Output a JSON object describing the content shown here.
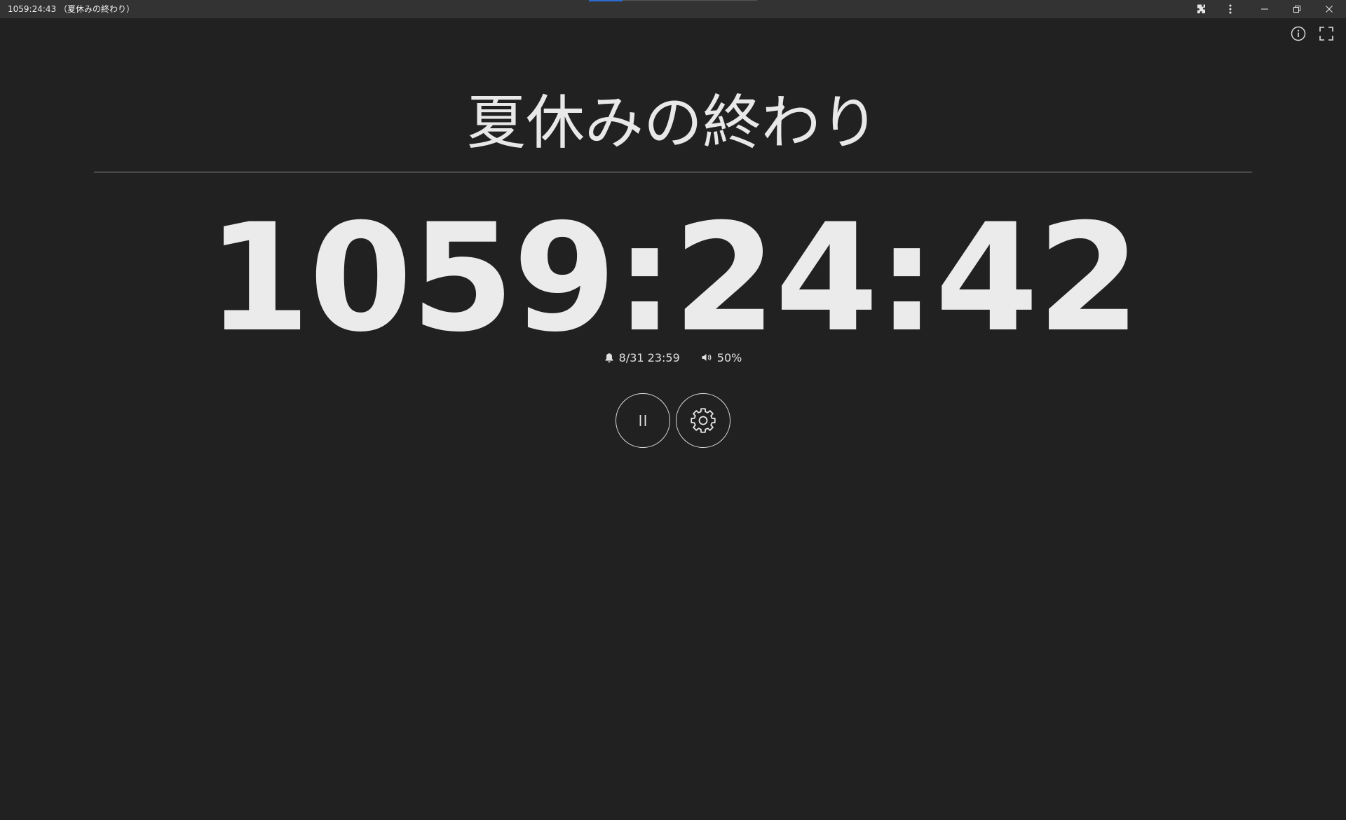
{
  "window": {
    "title": "1059:24:43 （夏休みの終わり）",
    "controls": {
      "extensions_icon": "puzzle-icon",
      "menu_icon": "kebab-menu-icon",
      "minimize_icon": "minimize-icon",
      "restore_icon": "restore-icon",
      "close_icon": "close-icon"
    }
  },
  "toolbar": {
    "info_icon": "info-icon",
    "fullscreen_icon": "fullscreen-icon"
  },
  "timer": {
    "event_name": "夏休みの終わり",
    "remaining": "1059:24:42",
    "target_datetime": "8/31 23:59",
    "volume": "50%"
  },
  "controls": {
    "pause_icon": "pause-icon",
    "settings_icon": "gear-icon"
  },
  "colors": {
    "background": "#212121",
    "titlebar": "#333333",
    "text": "#ebebeb",
    "accent": "#2b6bd6"
  }
}
